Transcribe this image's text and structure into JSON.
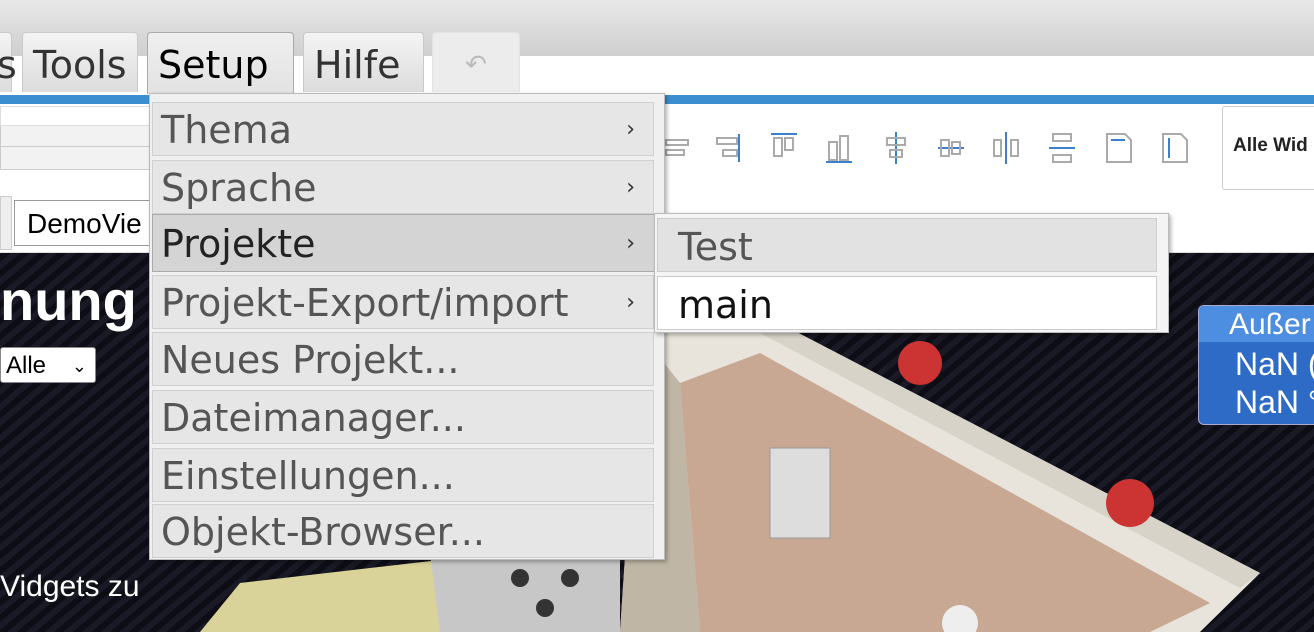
{
  "menubar": {
    "partial_tab_label": "s",
    "tabs": [
      {
        "label": "Tools"
      },
      {
        "label": "Setup"
      },
      {
        "label": "Hilfe"
      }
    ],
    "undo_icon": "undo-arrow-icon"
  },
  "toolbar": {
    "alignment_icons": [
      "align-left-icon",
      "align-right-icon",
      "align-top-icon",
      "align-bottom-icon",
      "align-horizontal-center-icon",
      "align-vertical-center-icon",
      "distribute-horizontal-icon",
      "distribute-vertical-icon",
      "same-width-icon",
      "same-height-icon"
    ],
    "widgets_label": "Alle Wid",
    "view_name": "DemoVie"
  },
  "canvas": {
    "title": "nung",
    "filter_value": "Alle",
    "hint_text": "Vidgets zu",
    "weather_widget": {
      "title": "Außer",
      "line1": "NaN (",
      "line2": "NaN °"
    }
  },
  "setup_menu": {
    "items": [
      {
        "label": "Thema",
        "has_submenu": true
      },
      {
        "label": "Sprache",
        "has_submenu": true
      },
      {
        "label": "Projekte",
        "has_submenu": true,
        "active": true
      },
      {
        "label": "Projekt-Export/import",
        "has_submenu": true
      },
      {
        "label": "Neues Projekt...",
        "has_submenu": false
      },
      {
        "label": "Dateimanager...",
        "has_submenu": false
      },
      {
        "label": "Einstellungen...",
        "has_submenu": false
      },
      {
        "label": "Objekt-Browser...",
        "has_submenu": false
      }
    ],
    "arrow_glyph": "›"
  },
  "projects_submenu": {
    "items": [
      {
        "label": "Test"
      },
      {
        "label": "main"
      }
    ]
  },
  "colors": {
    "accent_blue": "#3b8fd0",
    "weather_blue": "#2d6bc6",
    "icon_blue": "#3b7fcf"
  }
}
